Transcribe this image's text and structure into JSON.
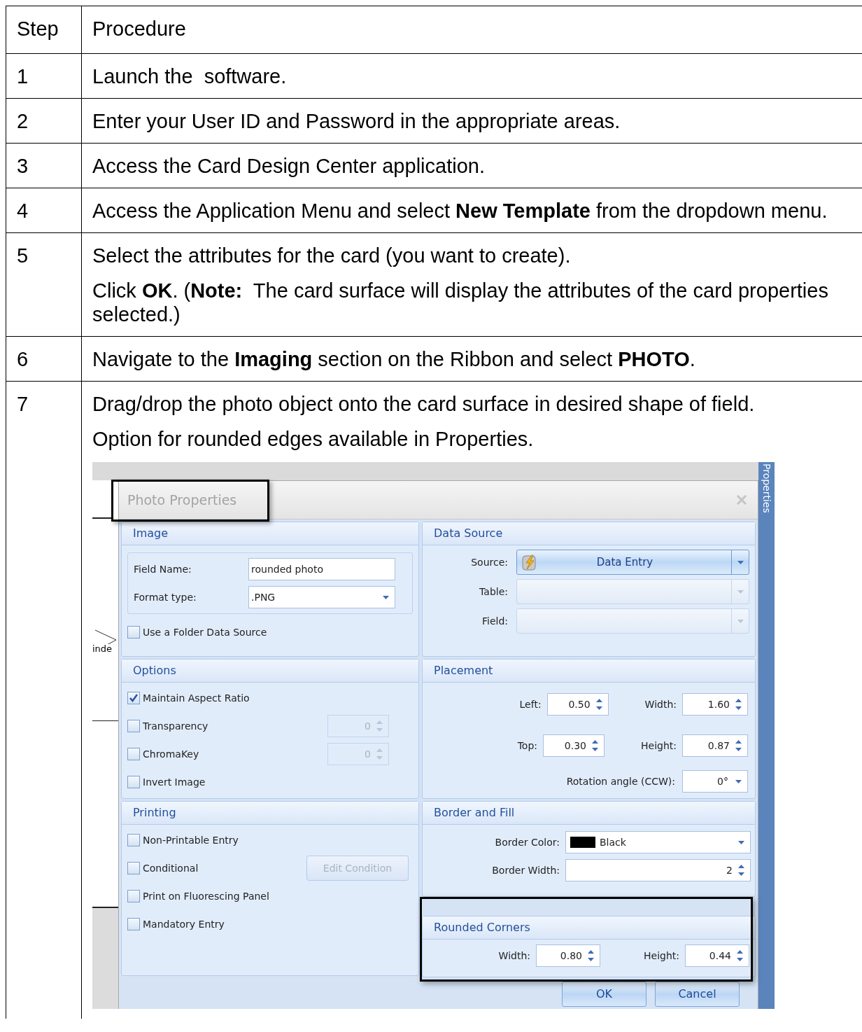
{
  "table": {
    "columns": [
      "Step",
      "Procedure"
    ],
    "rows": [
      {
        "step": "1",
        "paragraphs": [
          "Launch the  software."
        ]
      },
      {
        "step": "2",
        "paragraphs": [
          "Enter your User ID and Password in the appropriate areas."
        ]
      },
      {
        "step": "3",
        "paragraphs": [
          "Access the Card Design Center application."
        ]
      },
      {
        "step": "4",
        "paragraphs": [
          "Access the Application Menu and select **New Template** from the dropdown menu."
        ]
      },
      {
        "step": "5",
        "paragraphs": [
          "Select the attributes for the card (you want to create).",
          "Click **OK**. (**Note:**  The card surface will display the attributes of the card properties selected.)"
        ]
      },
      {
        "step": "6",
        "paragraphs": [
          "Navigate to the **Imaging** section on the Ribbon and select **PHOTO**."
        ]
      },
      {
        "step": "7",
        "paragraphs": [
          "Drag/drop the photo object onto the card surface in desired shape of field.",
          "Option for rounded edges available in Properties."
        ],
        "screenshot": {
          "canvas_text": "inde",
          "side_panel": "Properties",
          "dialog": {
            "title": "Photo Properties",
            "title_highlighted": true,
            "image": {
              "heading": "Image",
              "fields": [
                {
                  "kind": "text",
                  "label": "Field Name:",
                  "value": "rounded photo"
                },
                {
                  "kind": "dropdown",
                  "label": "Format type:",
                  "value": ".PNG"
                }
              ],
              "checkbox": {
                "label": "Use a Folder Data Source",
                "checked": false
              }
            },
            "data_source": {
              "heading": "Data Source",
              "fields": [
                {
                  "label": "Source:",
                  "value": "Data Entry",
                  "active": true
                },
                {
                  "label": "Table:",
                  "active": false
                },
                {
                  "label": "Field:",
                  "active": false
                }
              ]
            },
            "options": {
              "heading": "Options",
              "items": [
                {
                  "label": "Maintain Aspect Ratio",
                  "checked": true
                },
                {
                  "label": "Transparency",
                  "checked": false,
                  "spin": {
                    "value": "0",
                    "disabled": true
                  }
                },
                {
                  "label": "ChromaKey",
                  "checked": false,
                  "spin": {
                    "value": "0",
                    "disabled": true
                  }
                },
                {
                  "label": "Invert Image",
                  "checked": false
                }
              ]
            },
            "placement": {
              "heading": "Placement",
              "rows": [
                [
                  {
                    "label": "Left:",
                    "value": "0.50"
                  },
                  {
                    "label": "Width:",
                    "value": "1.60"
                  }
                ],
                [
                  {
                    "label": "Top:",
                    "value": "0.30"
                  },
                  {
                    "label": "Height:",
                    "value": "0.87"
                  }
                ]
              ],
              "rotation": {
                "label": "Rotation angle (CCW):",
                "value": "0°"
              }
            },
            "printing": {
              "heading": "Printing",
              "items": [
                {
                  "label": "Non-Printable Entry",
                  "checked": false
                },
                {
                  "label": "Conditional",
                  "checked": false,
                  "button": {
                    "label": "Edit Condition",
                    "disabled": true
                  }
                },
                {
                  "label": "Print on Fluorescing Panel",
                  "checked": false
                },
                {
                  "label": "Mandatory Entry",
                  "checked": false
                }
              ]
            },
            "border_fill": {
              "heading": "Border and Fill",
              "color": {
                "label": "Border Color:",
                "value": "Black"
              },
              "width": {
                "label": "Border Width:",
                "value": "2"
              }
            },
            "rounded_corners": {
              "heading": "Rounded Corners",
              "highlighted": true,
              "spins": [
                {
                  "label": "Width:",
                  "value": "0.80"
                },
                {
                  "label": "Height:",
                  "value": "0.44"
                }
              ]
            },
            "buttons": [
              "OK",
              "Cancel"
            ]
          }
        }
      }
    ]
  }
}
